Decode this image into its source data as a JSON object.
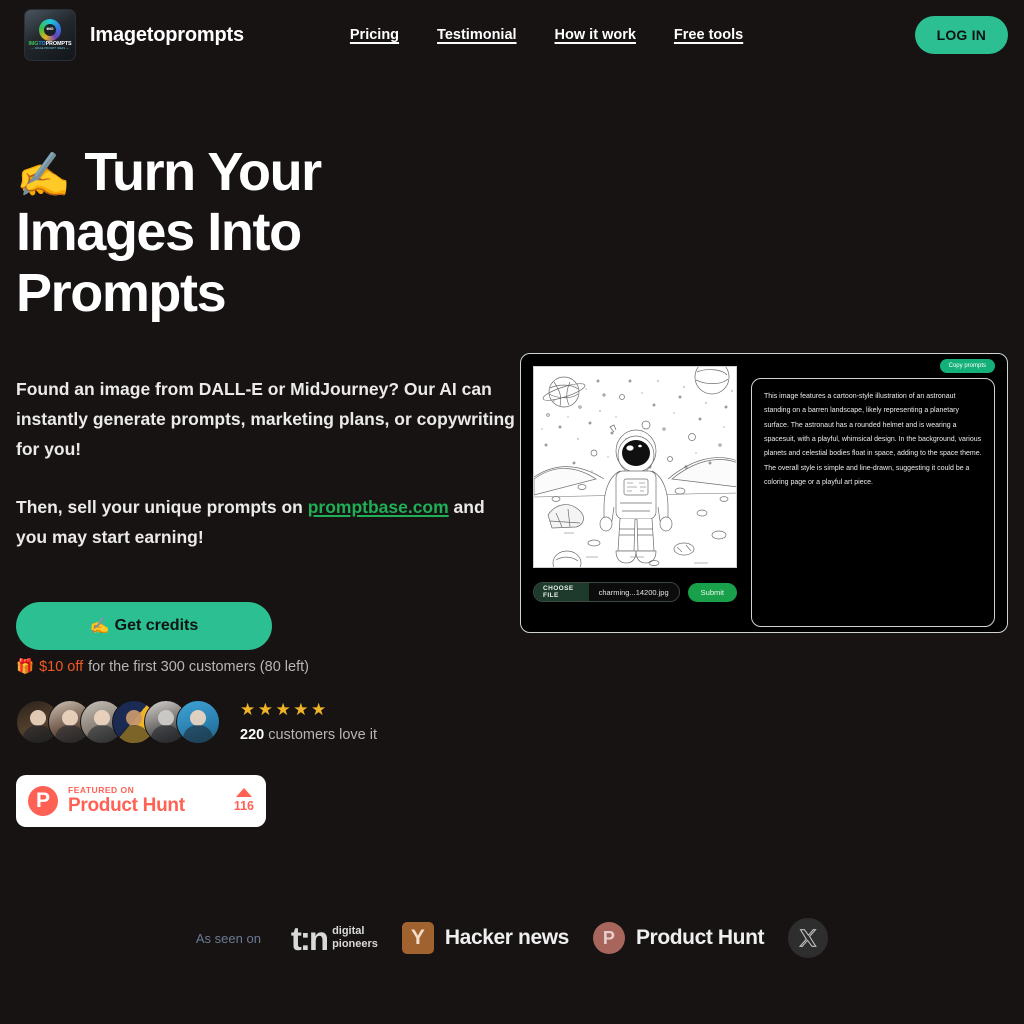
{
  "header": {
    "brand_name": "Imagetoprompts",
    "logo": {
      "ring_label": "IMG",
      "word_img": "IMG",
      "word_to": "TO",
      "word_prompts": "PROMPTS",
      "tagline": "— IMAGE PROMPT IDEAS —"
    },
    "nav": [
      {
        "label": "Pricing"
      },
      {
        "label": "Testimonial"
      },
      {
        "label": "How it work"
      },
      {
        "label": "Free tools"
      }
    ],
    "login_label": "LOG IN"
  },
  "hero": {
    "title_emoji": "✍",
    "title": "Turn Your Images Into Prompts",
    "paragraph1_before": "Found an image from DALL-E or MidJourney? Our AI can instantly generate prompts, marketing plans, or copywriting for you!",
    "paragraph2_before": "Then, sell your unique prompts on ",
    "paragraph2_link": "promptbase.com",
    "paragraph2_after": " and you may start earning!",
    "cta_emoji": "✍",
    "cta_label": "Get credits",
    "offer_emoji": "🎁",
    "offer_price": "$10 off",
    "offer_rest": "for the first 300 customers (80 left)"
  },
  "social_proof": {
    "stars": "★★★★★",
    "count": "220",
    "count_text": "customers love it"
  },
  "product_hunt_badge": {
    "logo_letter": "P",
    "kicker": "FEATURED ON",
    "name": "Product Hunt",
    "upvotes": "116"
  },
  "demo": {
    "copy_chip": "Copy prompts",
    "choose_file_label": "CHOOSE FILE",
    "file_name": "charming...14200.jpg",
    "submit_label": "Submit",
    "prompt_text": "This image features a cartoon-style illustration of an astronaut standing on a barren landscape, likely representing a planetary surface. The astronaut has a rounded helmet and is wearing a spacesuit, with a playful, whimsical design. In the background, various planets and celestial bodies float in space, adding to the space theme. The overall style is simple and line-drawn, suggesting it could be a coloring page or a playful art piece."
  },
  "as_seen_on": {
    "label": "As seen on",
    "t3n_mark": "t:n",
    "t3n_line1": "digital",
    "t3n_line2": "pioneers",
    "hackernews_letter": "Y",
    "hackernews_label": "Hacker news",
    "producthunt_letter": "P",
    "producthunt_label": "Product Hunt",
    "x_label": "X"
  },
  "colors": {
    "background": "#161312",
    "accent_teal": "#2bbf91",
    "link_green": "#1faf56",
    "offer_orange": "#f05a22",
    "product_hunt": "#ff6154",
    "star_gold": "#f0b429",
    "submit_green": "#18a04a"
  }
}
